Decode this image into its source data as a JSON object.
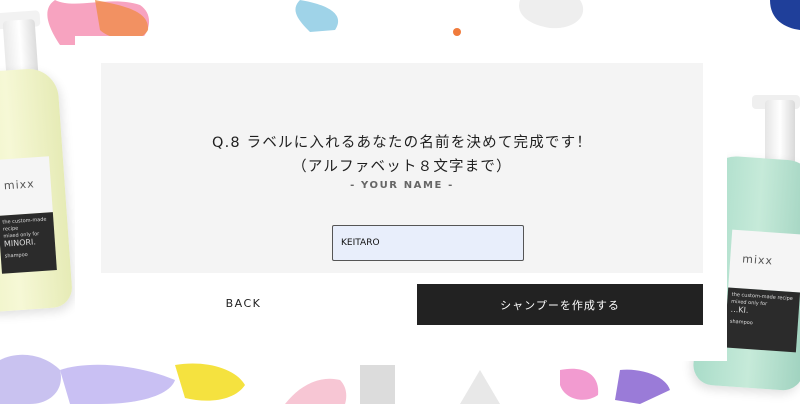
{
  "background": {
    "left_bottle": {
      "logo": "mixx",
      "label_lines": [
        "the custom-made recipe",
        "mixed only for",
        "MINORI."
      ],
      "type": "shampoo"
    },
    "right_bottle": {
      "logo": "mixx",
      "label_lines": [
        "the custom-made recipe",
        "mixed only for",
        "...KI."
      ],
      "type": "shampoo"
    }
  },
  "question": {
    "line1": "Q.8 ラベルに入れるあなたの名前を決めて完成です！",
    "line2": "（アルファベット８文字まで）",
    "subtitle": "- YOUR NAME -"
  },
  "name_input": {
    "value": "KEITARO"
  },
  "buttons": {
    "back": "BACK",
    "create": "シャンプーを作成する"
  },
  "colors": {
    "primary_button": "#222222",
    "input_bg": "#e8eefb",
    "panel_bg": "#f4f4f4"
  }
}
